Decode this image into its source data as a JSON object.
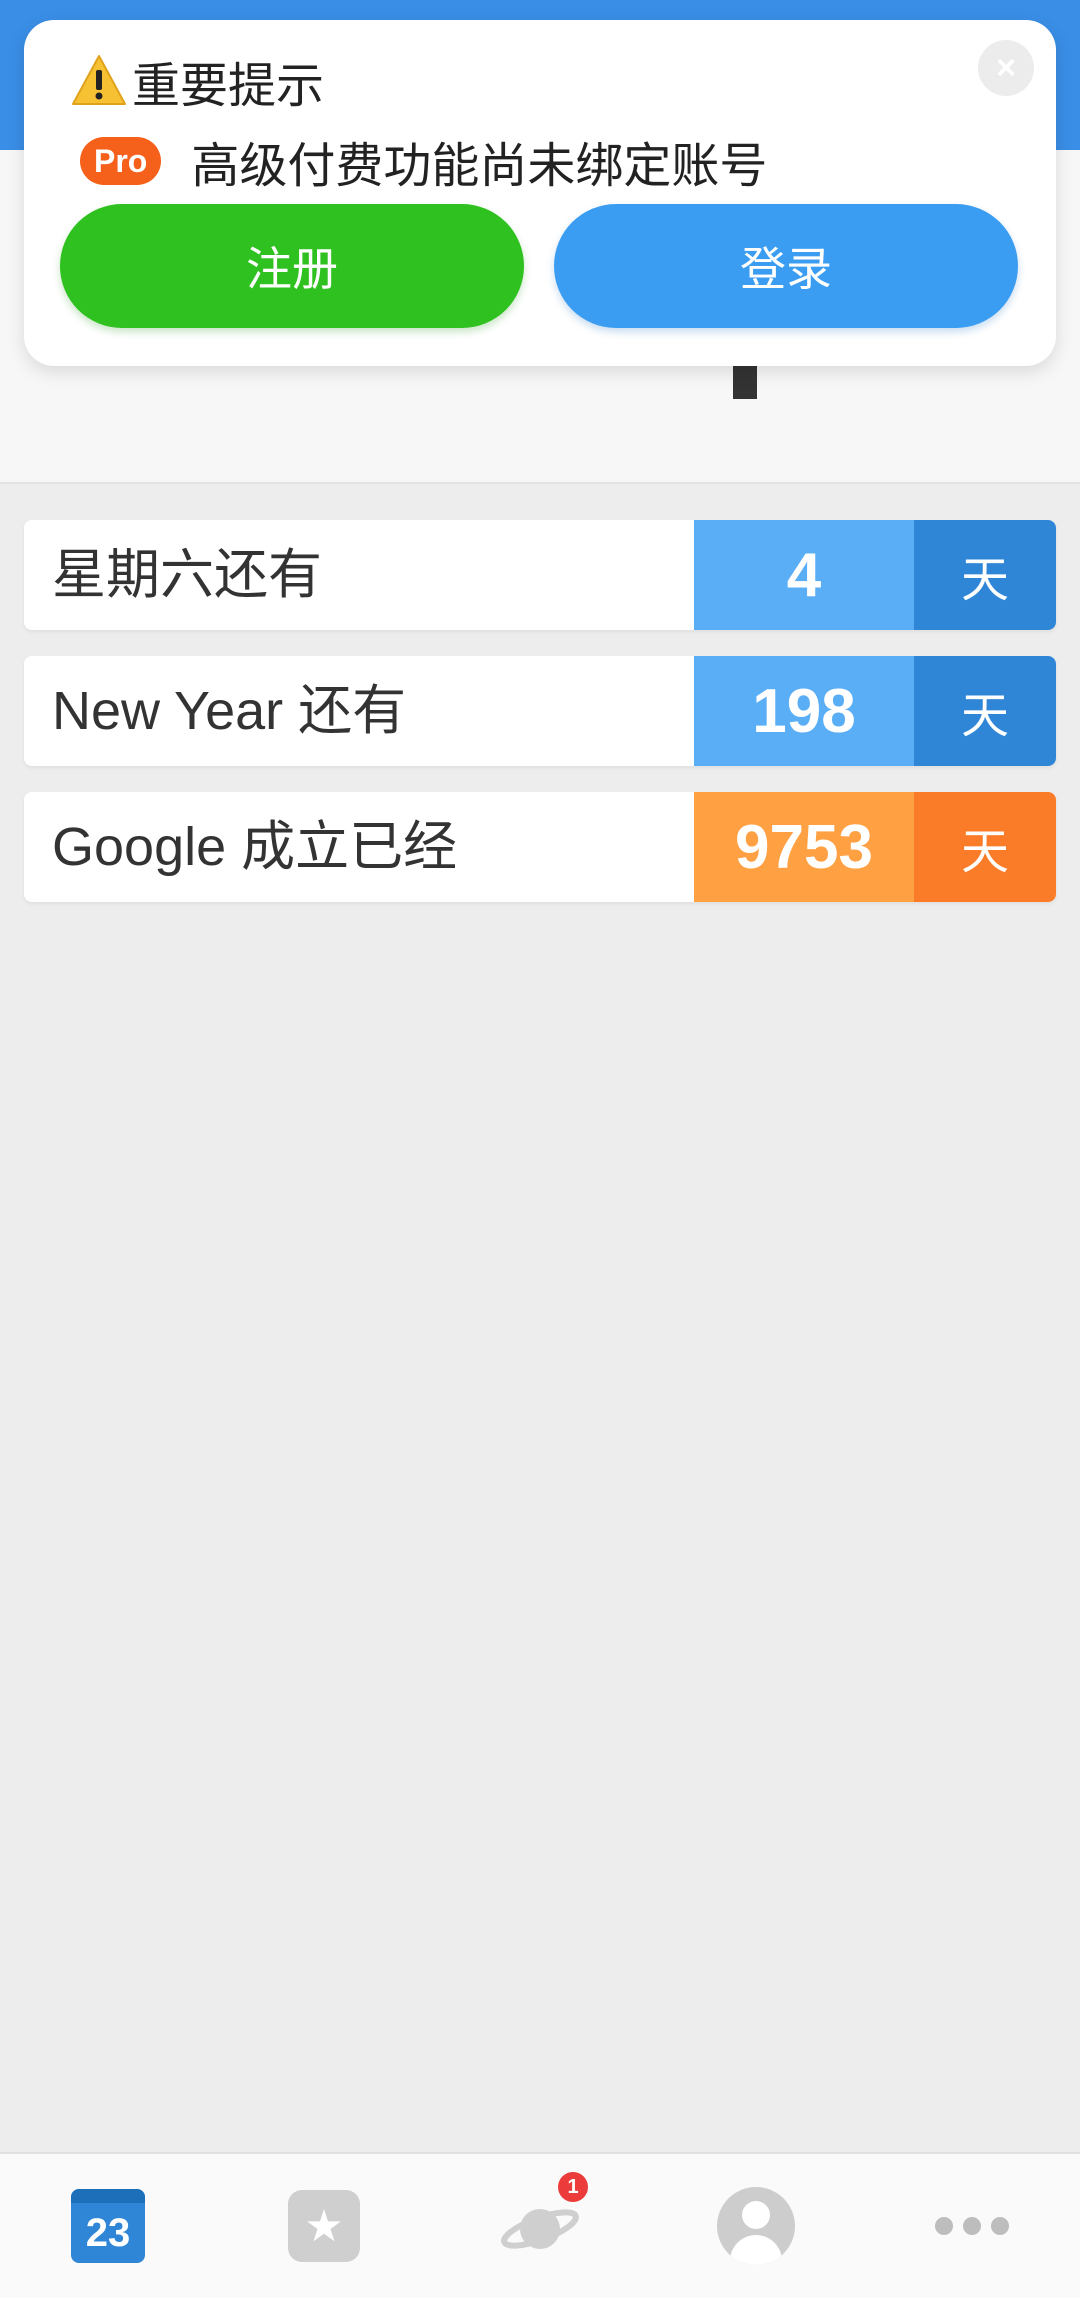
{
  "notice": {
    "title": "重要提示",
    "pro_badge": "Pro",
    "message": "高级付费功能尚未绑定账号",
    "close_symbol": "×",
    "register_label": "注册",
    "login_label": "登录"
  },
  "countdowns": [
    {
      "label": "星期六还有",
      "value": "4",
      "unit": "天",
      "color": "blue"
    },
    {
      "label": "New Year 还有",
      "value": "198",
      "unit": "天",
      "color": "blue"
    },
    {
      "label": "Google 成立已经",
      "value": "9753",
      "unit": "天",
      "color": "orange"
    }
  ],
  "colors": {
    "header_blue": "#3a8ee6",
    "register_green": "#2ec11f",
    "login_blue": "#3b9df2",
    "count_blue": "#5aaef5",
    "count_blue_dark": "#2f86d6",
    "count_orange": "#ffa043",
    "count_orange_dark": "#fb7c28",
    "pro_orange": "#f5601b"
  },
  "bottom_nav": {
    "calendar_day": "23",
    "calendar_icon": "calendar-icon",
    "favorites_icon": "star-card-icon",
    "discover_icon": "planet-icon",
    "discover_badge": "1",
    "profile_icon": "avatar-icon",
    "more_icon": "more-dots-icon"
  }
}
